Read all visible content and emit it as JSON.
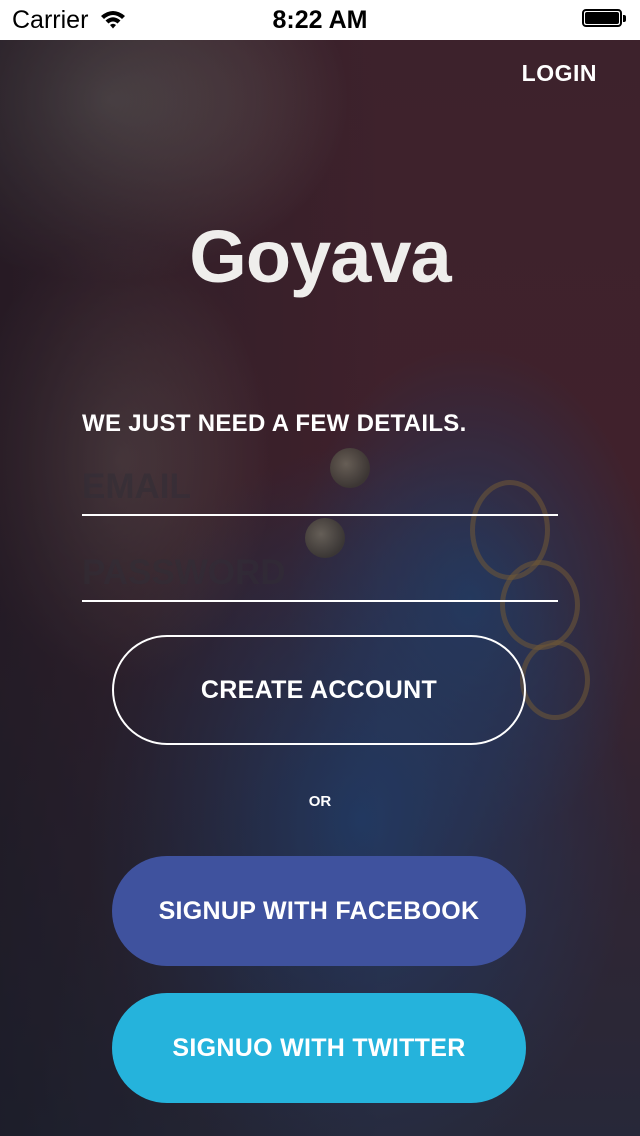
{
  "status_bar": {
    "carrier": "Carrier",
    "time": "8:22 AM"
  },
  "header": {
    "login_label": "LOGIN"
  },
  "brand": {
    "logo_text": "Goyava"
  },
  "form": {
    "tagline": "WE JUST NEED A FEW DETAILS.",
    "email_placeholder": "EMAIL",
    "email_value": "",
    "password_placeholder": "PASSWORD",
    "password_value": "",
    "create_account_label": "CREATE ACCOUNT",
    "or_label": "OR"
  },
  "social": {
    "facebook_label": "SIGNUP WITH FACEBOOK",
    "twitter_label": "SIGNUO WITH TWITTER"
  },
  "colors": {
    "facebook": "#3f529e",
    "twitter": "#25b3dc",
    "text": "#ffffff"
  }
}
